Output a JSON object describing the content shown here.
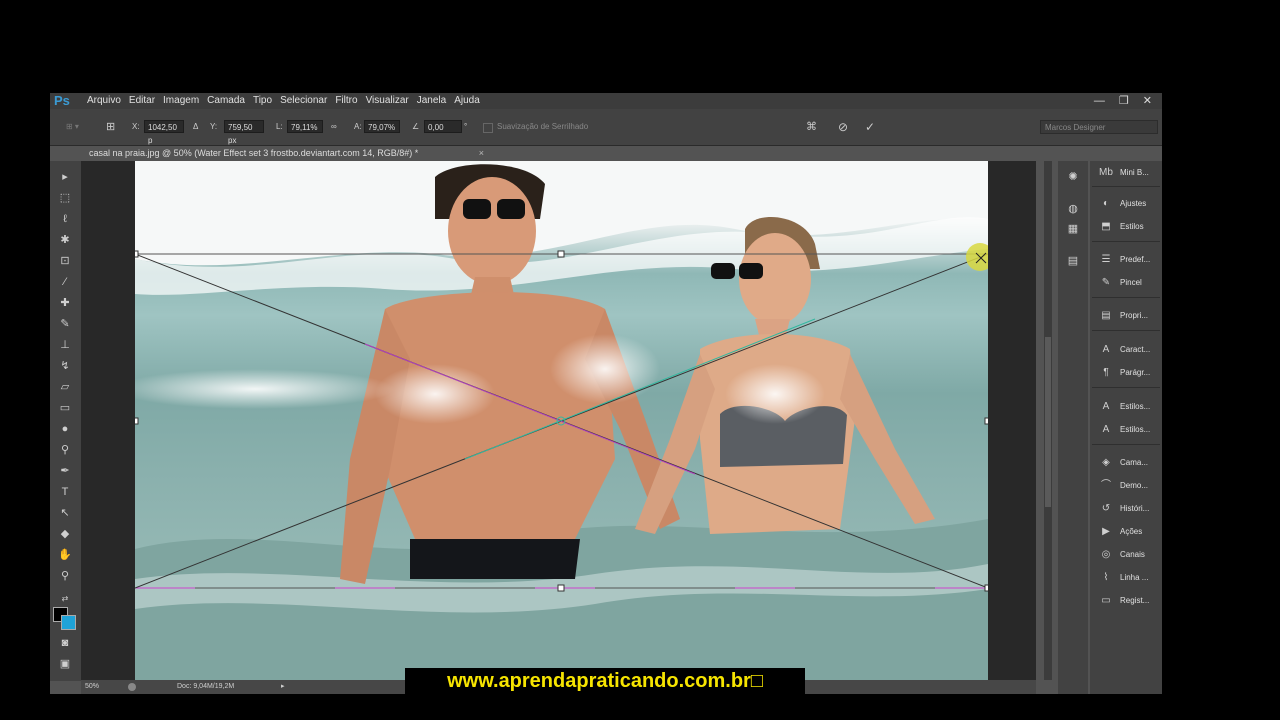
{
  "app": {
    "logo": "Ps",
    "menu": [
      "Arquivo",
      "Editar",
      "Imagem",
      "Camada",
      "Tipo",
      "Selecionar",
      "Filtro",
      "Visualizar",
      "Janela",
      "Ajuda"
    ],
    "window_controls": [
      "—",
      "❐",
      "✕"
    ]
  },
  "options": {
    "x_label": "X:",
    "x_value": "1042,50 p",
    "y_label": "Y:",
    "y_value": "759,50 px",
    "w_label": "L:",
    "w_value": "79,11%",
    "h_label": "A:",
    "h_value": "79,07%",
    "angle_value": "0,00",
    "angle_unit": "°",
    "antialias_label": "Suavização de Serrilhado",
    "workspace": "Marcos Designer"
  },
  "document": {
    "tab_title": "casal na praia.jpg @ 50% (Water Effect set 3 frostbo.deviantart.com 14, RGB/8#) *",
    "zoom": "50%",
    "doc_info": "Doc: 9,04M/19,2M"
  },
  "panels": [
    {
      "icon": "Mb",
      "label": "Mini B..."
    },
    {
      "icon": "◐",
      "label": "Ajustes"
    },
    {
      "icon": "⬒",
      "label": "Estilos"
    },
    {
      "icon": "☰",
      "label": "Predef..."
    },
    {
      "icon": "✎",
      "label": "Pincel"
    },
    {
      "icon": "▤",
      "label": "Propri..."
    },
    {
      "icon": "A",
      "label": "Caract..."
    },
    {
      "icon": "¶",
      "label": "Parágr..."
    },
    {
      "icon": "A",
      "label": "Estilos..."
    },
    {
      "icon": "A",
      "label": "Estilos..."
    },
    {
      "icon": "◈",
      "label": "Cama..."
    },
    {
      "icon": "⌒",
      "label": "Demo..."
    },
    {
      "icon": "↺",
      "label": "Históri..."
    },
    {
      "icon": "▶",
      "label": "Ações"
    },
    {
      "icon": "◎",
      "label": "Canais"
    },
    {
      "icon": "⌇",
      "label": "Linha ..."
    },
    {
      "icon": "▭",
      "label": "Regist..."
    }
  ],
  "banner": "www.aprendapraticando.com.br□",
  "colors": {
    "accent": "#3b9bd4",
    "banner_text": "#f6e400",
    "foreground": "#000000",
    "background": "#1fa3d8"
  }
}
